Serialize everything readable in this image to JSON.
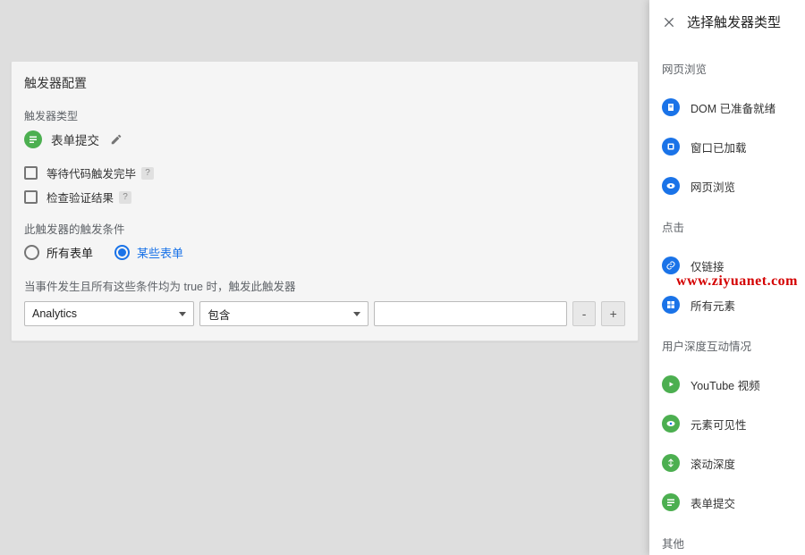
{
  "card": {
    "title": "触发器配置",
    "type_label": "触发器类型",
    "type_value": "表单提交",
    "checkbox1": "等待代码触发完毕",
    "checkbox2": "检查验证结果",
    "condition_header": "此触发器的触发条件",
    "radio_all": "所有表单",
    "radio_some": "某些表单",
    "condition_desc": "当事件发生且所有这些条件均为 true 时，触发此触发器",
    "filter_var": "Analytics",
    "filter_op": "包含",
    "btn_minus": "-",
    "btn_plus": "+",
    "help": "?"
  },
  "panel": {
    "title": "选择触发器类型",
    "groups": [
      {
        "label": "网页浏览",
        "items": [
          {
            "name": "dom-ready",
            "label": "DOM 已准备就绪",
            "icon": "doc",
            "color": "#1a73e8"
          },
          {
            "name": "window-loaded",
            "label": "窗口已加载",
            "icon": "box",
            "color": "#1a73e8"
          },
          {
            "name": "page-view",
            "label": "网页浏览",
            "icon": "eye",
            "color": "#1a73e8"
          }
        ]
      },
      {
        "label": "点击",
        "items": [
          {
            "name": "link-only",
            "label": "仅链接",
            "icon": "link",
            "color": "#1a73e8"
          },
          {
            "name": "all-elements",
            "label": "所有元素",
            "icon": "grid",
            "color": "#1a73e8"
          }
        ]
      },
      {
        "label": "用户深度互动情况",
        "items": [
          {
            "name": "youtube-video",
            "label": "YouTube 视频",
            "icon": "play",
            "color": "#4caf50"
          },
          {
            "name": "visibility",
            "label": "元素可见性",
            "icon": "eye",
            "color": "#4caf50"
          },
          {
            "name": "scroll-depth",
            "label": "滚动深度",
            "icon": "scroll",
            "color": "#4caf50"
          },
          {
            "name": "form-submit",
            "label": "表单提交",
            "icon": "form",
            "color": "#4caf50"
          }
        ]
      },
      {
        "label": "其他",
        "items": []
      }
    ]
  },
  "watermark": "www.ziyuanet.com"
}
